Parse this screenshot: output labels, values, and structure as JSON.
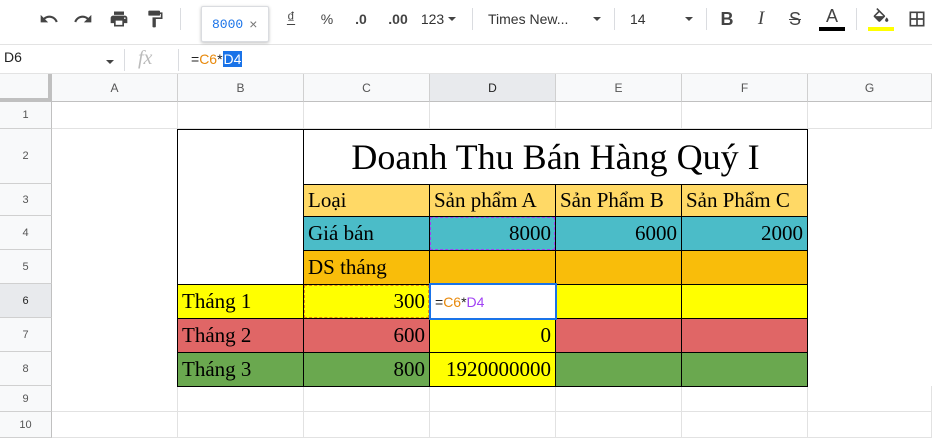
{
  "toolbar": {
    "items": [
      "undo-icon",
      "redo-icon",
      "print-icon",
      "paint-format-icon"
    ],
    "currency_symbol": "₫",
    "percent": "%",
    "decrease_decimal": ".0",
    "increase_decimal": ".00",
    "more_formats": "123",
    "font_family": "Times New...",
    "font_size": "14",
    "bold": "B",
    "italic": "I",
    "strikethrough": "S",
    "text_color_label": "A",
    "text_color": "#000000",
    "fill_color": "#ffff00"
  },
  "tooltip": {
    "value": "8000",
    "close": "×"
  },
  "formula_bar": {
    "name_box": "D6",
    "fx": "fx",
    "formula_prefix": "=",
    "formula_ref1": "C6",
    "formula_op": "*",
    "formula_ref2": "D4"
  },
  "columns": [
    "A",
    "B",
    "C",
    "D",
    "E",
    "F",
    "G"
  ],
  "rows": [
    "1",
    "2",
    "3",
    "4",
    "5",
    "6",
    "7",
    "8",
    "9",
    "10"
  ],
  "sheet": {
    "title": "Doanh Thu Bán Hàng Quý I",
    "header": [
      "Loại",
      "Sản phẩm A",
      "Sản Phẩm B",
      "Sản Phẩm C"
    ],
    "price_label": "Giá bán",
    "prices": [
      "8000",
      "6000",
      "2000"
    ],
    "sales_label": "DS tháng",
    "months": [
      {
        "label": "Tháng 1",
        "qty": "300",
        "d": ""
      },
      {
        "label": "Tháng 2",
        "qty": "600",
        "d": "0"
      },
      {
        "label": "Tháng 3",
        "qty": "800",
        "d": "1920000000"
      }
    ],
    "edit_prefix": "=",
    "edit_ref1": "C6",
    "edit_op": "*",
    "edit_ref2": "D4"
  },
  "colors": {
    "header_row": "#ffd966",
    "price_row": "#4bbcc8",
    "sales_row": "#f9bd0a",
    "month1": "#ffff00",
    "month2": "#e06666",
    "month3": "#6aa84f",
    "selection": "#1a73e8"
  }
}
